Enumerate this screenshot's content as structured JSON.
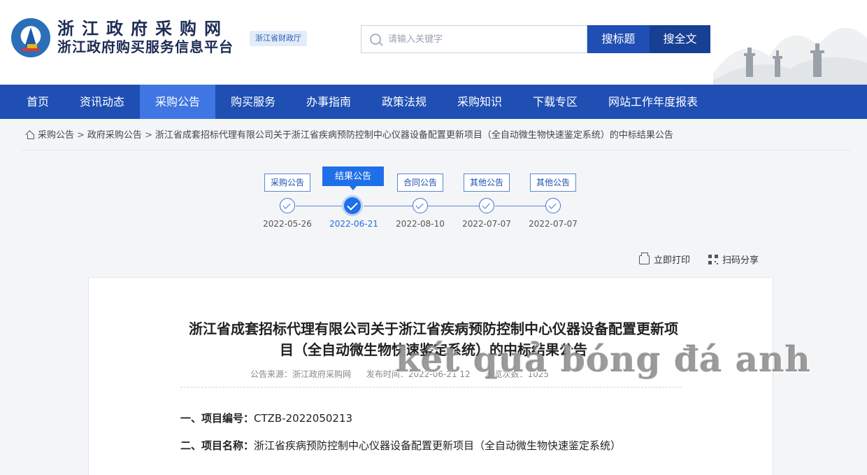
{
  "header": {
    "site_title": "浙江政府采购网",
    "site_subtitle": "浙江政府购买服务信息平台",
    "dept_badge": "浙江省财政厅",
    "search_placeholder": "请输入关键字",
    "btn_search_title": "搜标题",
    "btn_search_full": "搜全文"
  },
  "nav": {
    "items": [
      "首页",
      "资讯动态",
      "采购公告",
      "购买服务",
      "办事指南",
      "政策法规",
      "采购知识",
      "下载专区",
      "网站工作年度报表"
    ],
    "active_index": 2
  },
  "breadcrumb": [
    "采购公告",
    "政府采购公告",
    "浙江省成套招标代理有限公司关于浙江省疾病预防控制中心仪器设备配置更新项目（全自动微生物快速鉴定系统）的中标结果公告"
  ],
  "timeline": {
    "steps": [
      {
        "label": "采购公告",
        "date": "2022-05-26"
      },
      {
        "label": "结果公告",
        "date": "2022-06-21"
      },
      {
        "label": "合同公告",
        "date": "2022-08-10"
      },
      {
        "label": "其他公告",
        "date": "2022-07-07"
      },
      {
        "label": "其他公告",
        "date": "2022-07-07"
      }
    ],
    "active_index": 1
  },
  "actions": {
    "print": "立即打印",
    "share": "扫码分享"
  },
  "article": {
    "title": "浙江省成套招标代理有限公司关于浙江省疾病预防控制中心仪器设备配置更新项目（全自动微生物快速鉴定系统）的中标结果公告",
    "meta_source": "公告来源：浙江政府采购网",
    "meta_date": "发布时间：2022-06-21 12",
    "meta_views": "浏览次数：1025",
    "fields": [
      {
        "label": "一、项目编号：",
        "value": "CTZB-2022050213"
      },
      {
        "label": "二、项目名称：",
        "value": "浙江省疾病预防控制中心仪器设备配置更新项目（全自动微生物快速鉴定系统）"
      }
    ]
  },
  "watermark": "kết quả bóng đá anh",
  "colors": {
    "nav_bg": "#1f4fb3",
    "nav_active": "#3f76e3",
    "accent": "#1f6fe8"
  }
}
